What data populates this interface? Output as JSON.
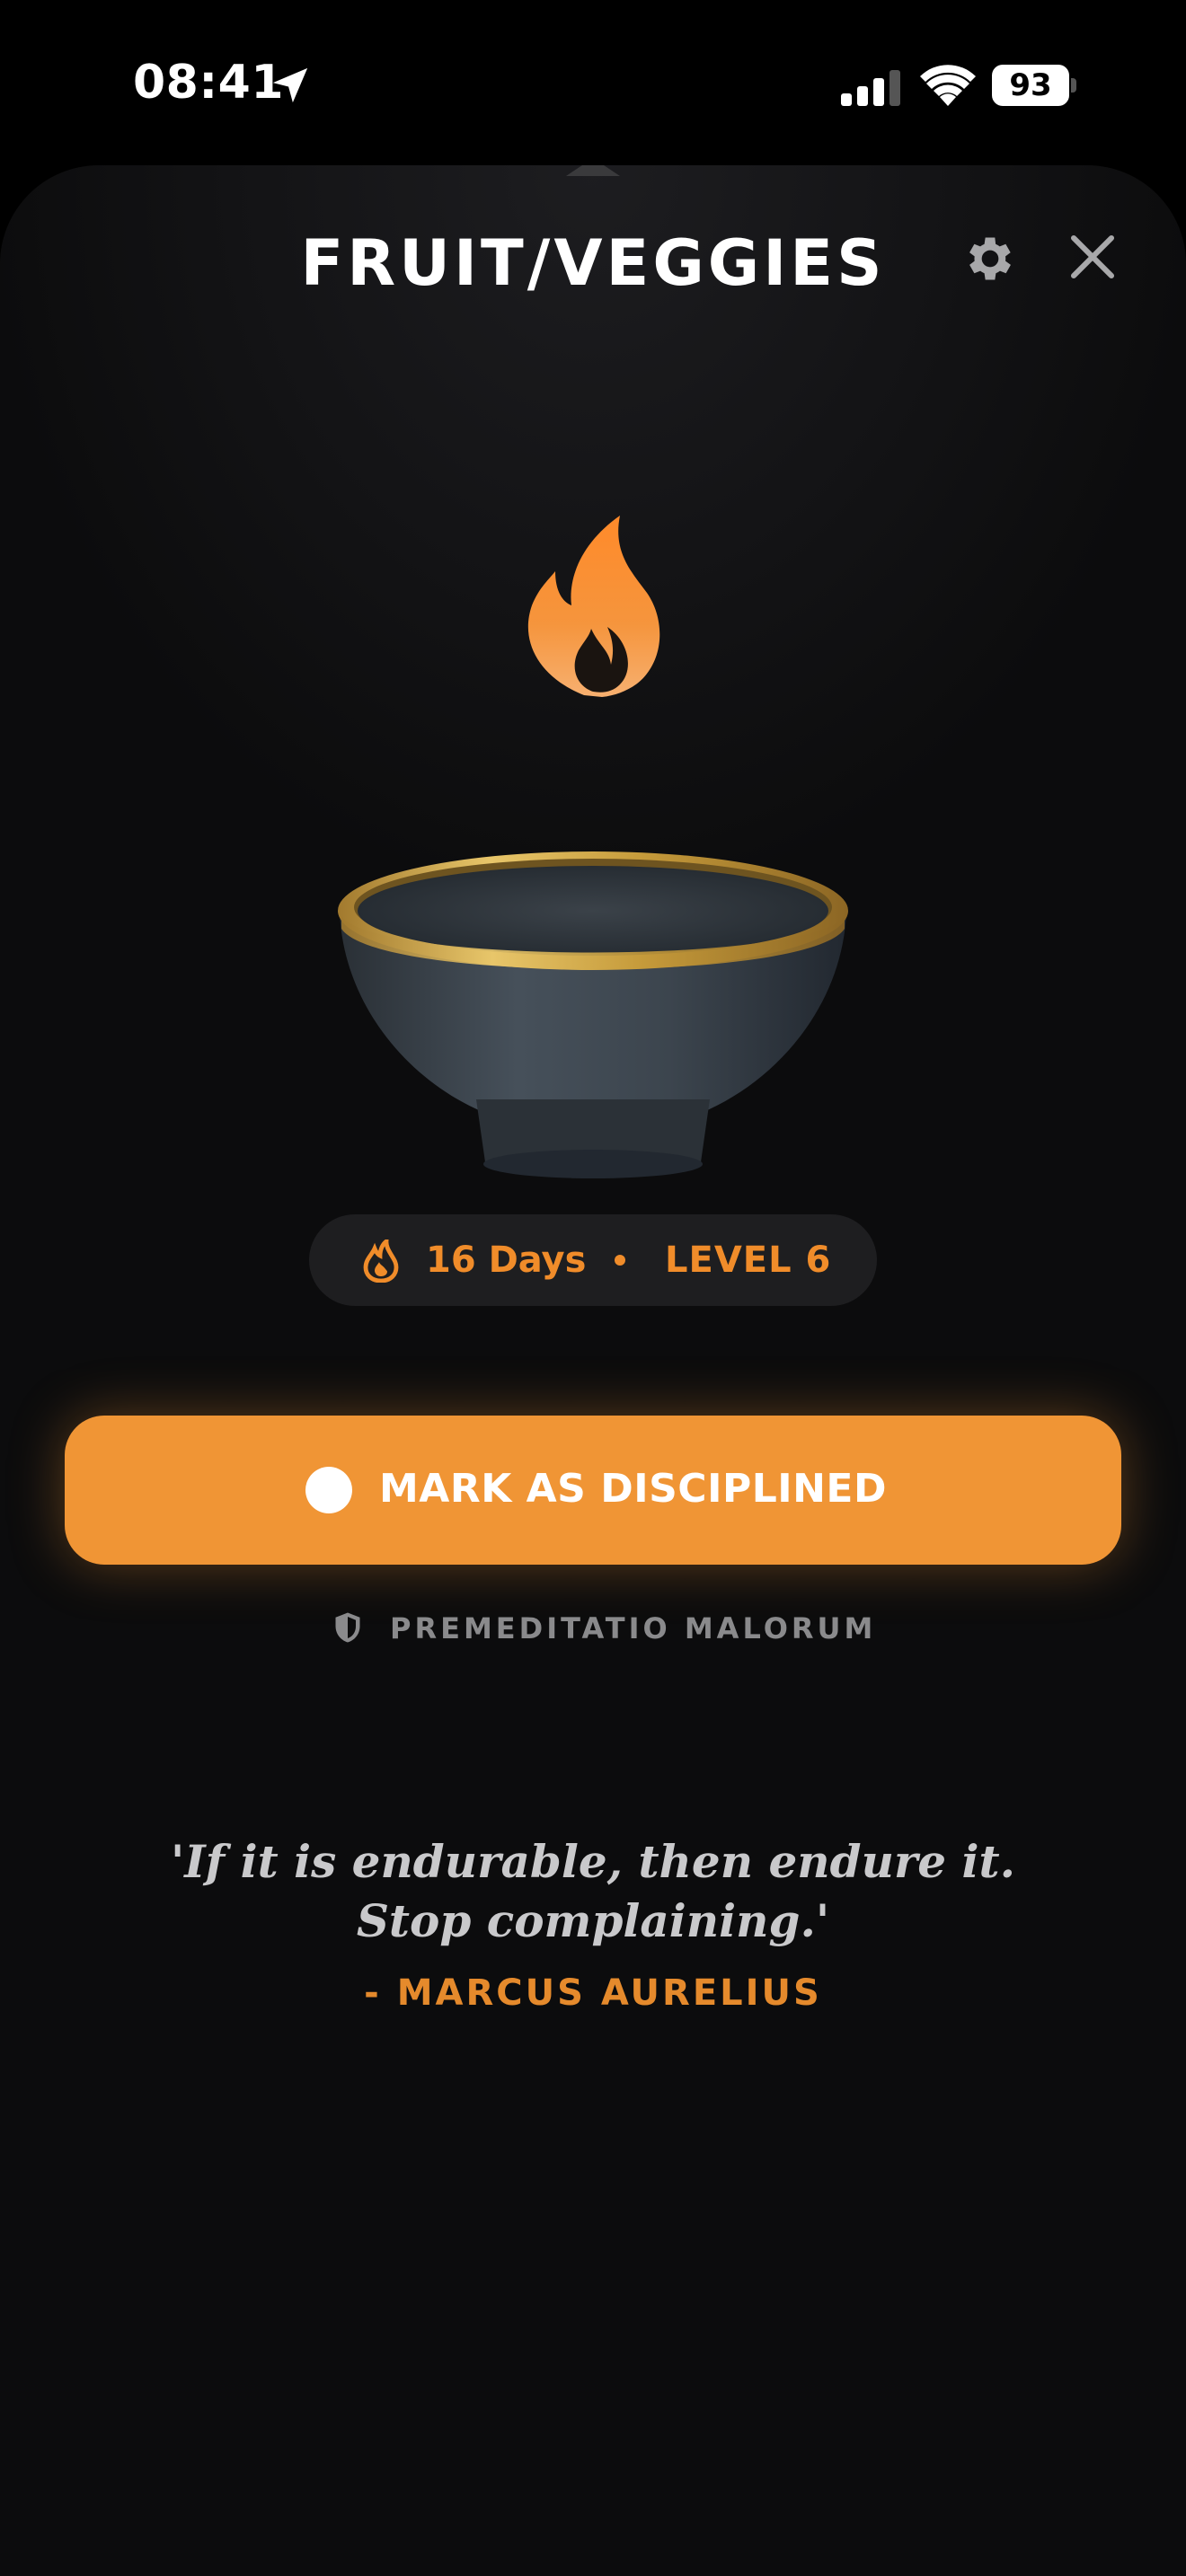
{
  "status_bar": {
    "time": "08:41",
    "battery": "93",
    "icons": [
      "location-arrow-icon",
      "cellular-signal-icon",
      "wifi-icon",
      "battery-icon"
    ]
  },
  "header": {
    "title": "FRUIT/VEGGIES",
    "icons": [
      "gear-icon",
      "close-icon"
    ]
  },
  "illustration": {
    "icons": [
      "flame-icon",
      "bowl-illustration"
    ]
  },
  "streak": {
    "days": "16 Days",
    "level": "LEVEL 6",
    "icon": "flame-icon"
  },
  "action": {
    "label": "MARK AS DISCIPLINED"
  },
  "practice": {
    "label": "PREMEDITATIO MALORUM",
    "icon": "shield-icon"
  },
  "quote": {
    "text": "'If it is endurable, then endure it. Stop complaining.'",
    "author": "- MARCUS AURELIUS"
  },
  "colors": {
    "accent": "#f09535",
    "accent_text": "#f08c2a",
    "background": "#0c0c0d",
    "pill": "#1e1e20",
    "muted": "#8a8a8c"
  }
}
